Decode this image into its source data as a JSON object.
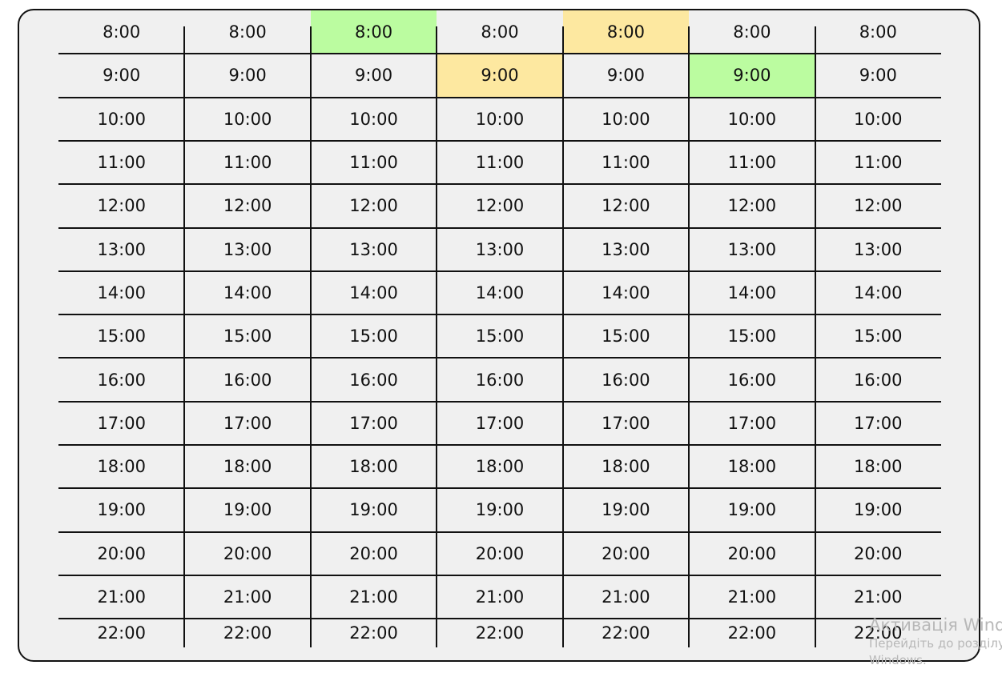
{
  "schedule": {
    "times": [
      "8:00",
      "9:00",
      "10:00",
      "11:00",
      "12:00",
      "13:00",
      "14:00",
      "15:00",
      "16:00",
      "17:00",
      "18:00",
      "19:00",
      "20:00",
      "21:00",
      "22:00"
    ],
    "column_count": 7,
    "highlights": [
      {
        "col": 2,
        "row": 0,
        "color": "#bbfca0"
      },
      {
        "col": 4,
        "row": 0,
        "color": "#fde8a0"
      },
      {
        "col": 3,
        "row": 1,
        "color": "#fde8a0"
      },
      {
        "col": 5,
        "row": 1,
        "color": "#bbfca0"
      }
    ]
  },
  "watermark": {
    "title": "Активація Windows",
    "line1": "Перейдіть до розділу",
    "line2": "Windows."
  }
}
